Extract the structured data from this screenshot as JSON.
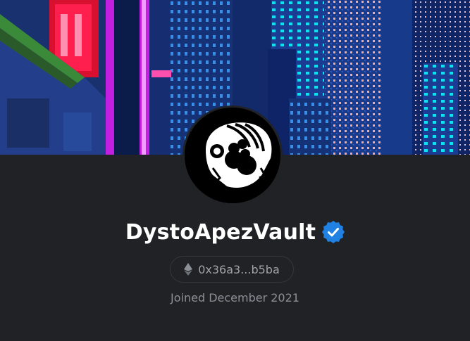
{
  "profile": {
    "name": "DystoApezVault",
    "address": "0x36a3...b5ba",
    "joined": "Joined December 2021"
  },
  "icons": {
    "verified": "verified-badge-icon",
    "ethereum": "ethereum-icon"
  },
  "colors": {
    "background": "#202225",
    "verified_blue": "#2081e2",
    "text_primary": "#ffffff",
    "text_secondary": "#8b8f96"
  }
}
